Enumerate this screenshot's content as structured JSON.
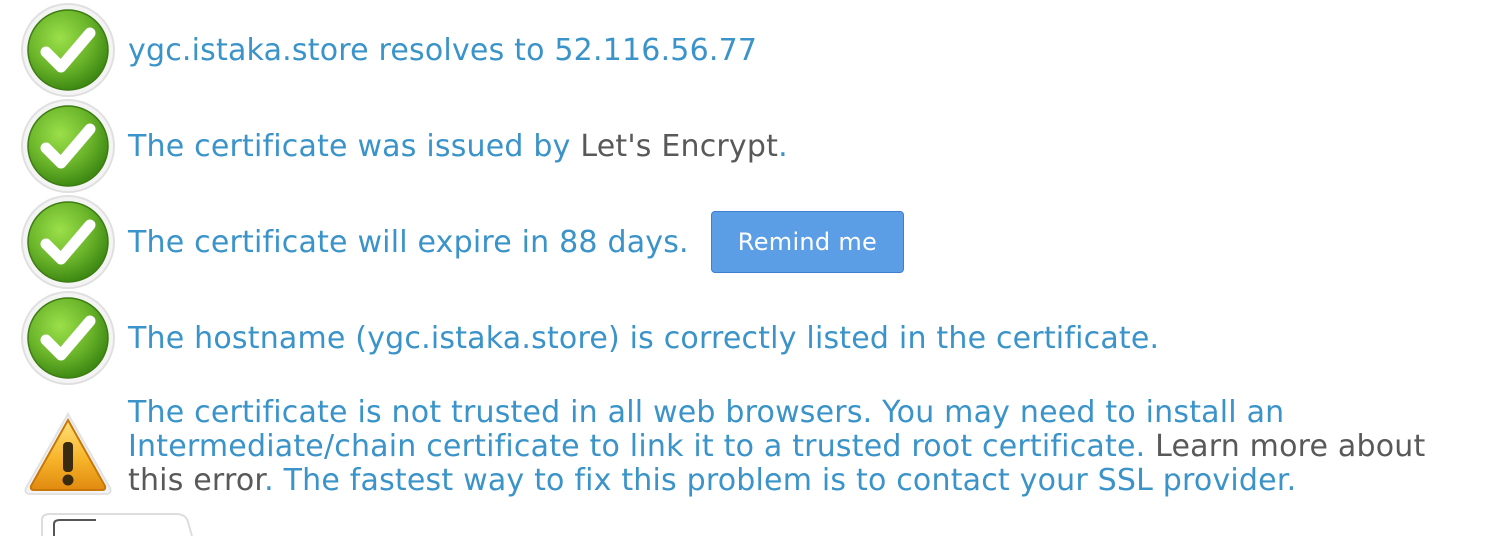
{
  "checks": [
    {
      "status": "pass",
      "text": "ygc.istaka.store resolves to 52.116.56.77"
    },
    {
      "status": "pass",
      "text_prefix": "The certificate was issued by ",
      "issuer": "Let's Encrypt",
      "text_suffix": "."
    },
    {
      "status": "pass",
      "text": "The certificate will expire in 88 days.",
      "button_label": "Remind me"
    },
    {
      "status": "pass",
      "text": "The hostname (ygc.istaka.store) is correctly listed in the certificate."
    },
    {
      "status": "warning",
      "text_prefix": "The certificate is not trusted in all web browsers. You may need to install an Intermediate/chain certificate to link it to a trusted root certificate. ",
      "link_text": "Learn more about this error",
      "text_suffix": ". The fastest way to fix this problem is to contact your SSL provider."
    }
  ],
  "icons": {
    "pass": "checkmark-icon",
    "warning": "warning-triangle-icon"
  },
  "colors": {
    "text_blue": "#3a93c9",
    "text_gray": "#595959",
    "button_blue": "#5b9ee6",
    "check_green": "#6bb52b",
    "warning_orange": "#f2a51e"
  }
}
